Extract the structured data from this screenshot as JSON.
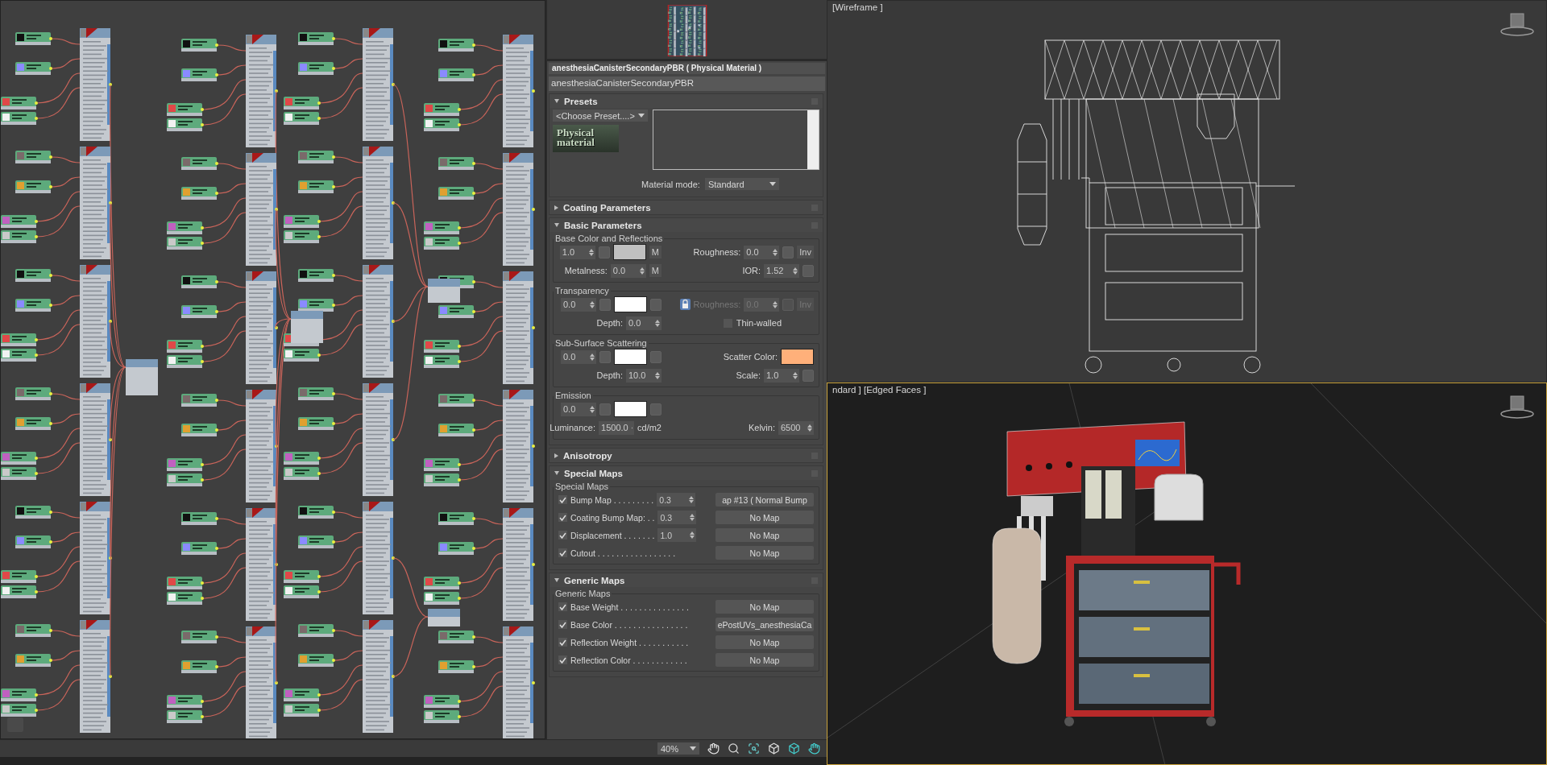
{
  "material": {
    "title": "anesthesiaCanisterSecondaryPBR  ( Physical Material )",
    "name": "anesthesiaCanisterSecondaryPBR"
  },
  "rollouts": [
    {
      "kind": "presets",
      "title": "Presets",
      "expanded": true,
      "preset": "<Choose Preset....>",
      "logo": "Physical material",
      "mode_label": "Material mode:",
      "mode": "Standard"
    },
    {
      "title": "Coating Parameters",
      "expanded": false
    },
    {
      "kind": "params",
      "title": "Basic Parameters",
      "expanded": true,
      "groups": [
        {
          "title": "Base Color and Reflections",
          "rows": [
            {
              "left": [
                {
                  "kind": "spinner",
                  "value": "1.0"
                },
                {
                  "kind": "slot"
                },
                {
                  "kind": "swatch",
                  "color": "#c0c0c0"
                },
                {
                  "kind": "button",
                  "text": "M"
                }
              ],
              "right": [
                {
                  "kind": "label",
                  "text": "Roughness:"
                },
                {
                  "kind": "spinner",
                  "value": "0.0"
                },
                {
                  "kind": "slot"
                },
                {
                  "kind": "button",
                  "text": "Inv"
                }
              ]
            },
            {
              "left": [
                {
                  "kind": "label",
                  "text": "Metalness:"
                },
                {
                  "kind": "spinner",
                  "value": "0.0"
                },
                {
                  "kind": "button",
                  "text": "M"
                }
              ],
              "right": [
                {
                  "kind": "label",
                  "text": "IOR:"
                },
                {
                  "kind": "spinner",
                  "value": "1.52"
                },
                {
                  "kind": "slot"
                }
              ]
            }
          ]
        },
        {
          "title": "Transparency",
          "rows": [
            {
              "left": [
                {
                  "kind": "spinner",
                  "value": "0.0"
                },
                {
                  "kind": "slot"
                },
                {
                  "kind": "swatch",
                  "color": "#ffffff"
                },
                {
                  "kind": "slot"
                }
              ],
              "right": [
                {
                  "kind": "lock",
                  "disabled": false
                },
                {
                  "kind": "label",
                  "text": "Roughness:",
                  "disabled": true
                },
                {
                  "kind": "spinner",
                  "value": "0.0",
                  "disabled": true
                },
                {
                  "kind": "slot",
                  "disabled": true
                },
                {
                  "kind": "button",
                  "text": "Inv",
                  "disabled": true
                }
              ]
            },
            {
              "left": [
                {
                  "kind": "label",
                  "text": "Depth:"
                },
                {
                  "kind": "spinner",
                  "value": "0.0"
                }
              ],
              "right": [
                {
                  "kind": "checkbox",
                  "text": "Thin-walled",
                  "checked": false
                }
              ]
            }
          ]
        },
        {
          "title": "Sub-Surface Scattering",
          "rows": [
            {
              "left": [
                {
                  "kind": "spinner",
                  "value": "0.0"
                },
                {
                  "kind": "slot"
                },
                {
                  "kind": "swatch",
                  "color": "#ffffff"
                },
                {
                  "kind": "slot"
                }
              ],
              "right": [
                {
                  "kind": "label",
                  "text": "Scatter Color:"
                },
                {
                  "kind": "swatch",
                  "color": "#ffb07a"
                }
              ]
            },
            {
              "left": [
                {
                  "kind": "label",
                  "text": "Depth:"
                },
                {
                  "kind": "spinner",
                  "value": "10.0"
                }
              ],
              "right": [
                {
                  "kind": "label",
                  "text": "Scale:"
                },
                {
                  "kind": "spinner",
                  "value": "1.0"
                },
                {
                  "kind": "slot"
                }
              ]
            }
          ]
        },
        {
          "title": "Emission",
          "rows": [
            {
              "left": [
                {
                  "kind": "spinner",
                  "value": "0.0"
                },
                {
                  "kind": "slot"
                },
                {
                  "kind": "swatch",
                  "color": "#ffffff"
                },
                {
                  "kind": "slot"
                }
              ],
              "right": []
            },
            {
              "left": [
                {
                  "kind": "label",
                  "text": "Luminance:"
                },
                {
                  "kind": "spinner",
                  "value": "1500.0"
                },
                {
                  "kind": "label",
                  "text": "cd/m2"
                }
              ],
              "right": [
                {
                  "kind": "label",
                  "text": "Kelvin:"
                },
                {
                  "kind": "spinner",
                  "value": "6500"
                }
              ]
            }
          ]
        }
      ]
    },
    {
      "title": "Anisotropy",
      "expanded": false
    },
    {
      "kind": "maps",
      "title": "Special Maps",
      "expanded": true,
      "group": "Special Maps",
      "maps": [
        {
          "checked": true,
          "label": "Bump Map . . . . . . . . .",
          "amount": "0.3",
          "map": "ap #13  ( Normal Bump"
        },
        {
          "checked": true,
          "label": "Coating Bump Map: . .",
          "amount": "0.3",
          "map": "No Map"
        },
        {
          "checked": true,
          "label": "Displacement . . . . . . .",
          "amount": "1.0",
          "map": "No Map"
        },
        {
          "checked": true,
          "label": "Cutout . . . . . . . . . . . . . . . . .",
          "map": "No Map"
        }
      ]
    },
    {
      "kind": "maps",
      "title": "Generic Maps",
      "expanded": true,
      "group": "Generic Maps",
      "maps": [
        {
          "checked": true,
          "label": "Base Weight . . . . . . . . . . . . . . .",
          "map": "No Map"
        },
        {
          "checked": true,
          "label": "Base Color . . . . . . . . . . . . . . . .",
          "map": "ePostUVs_anesthesiaCa"
        },
        {
          "checked": true,
          "label": "Reflection Weight . . . . . . . . . . .",
          "map": "No Map"
        },
        {
          "checked": true,
          "label": "Reflection Color . . . . . . . . . . . .",
          "map": "No Map"
        }
      ]
    }
  ],
  "toolbar": {
    "zoom": "40%"
  },
  "viewports": [
    {
      "kind": "wireframe",
      "label": "[Wireframe ]"
    },
    {
      "kind": "shaded",
      "label": "ndard ] [Edged Faces ]"
    }
  ]
}
